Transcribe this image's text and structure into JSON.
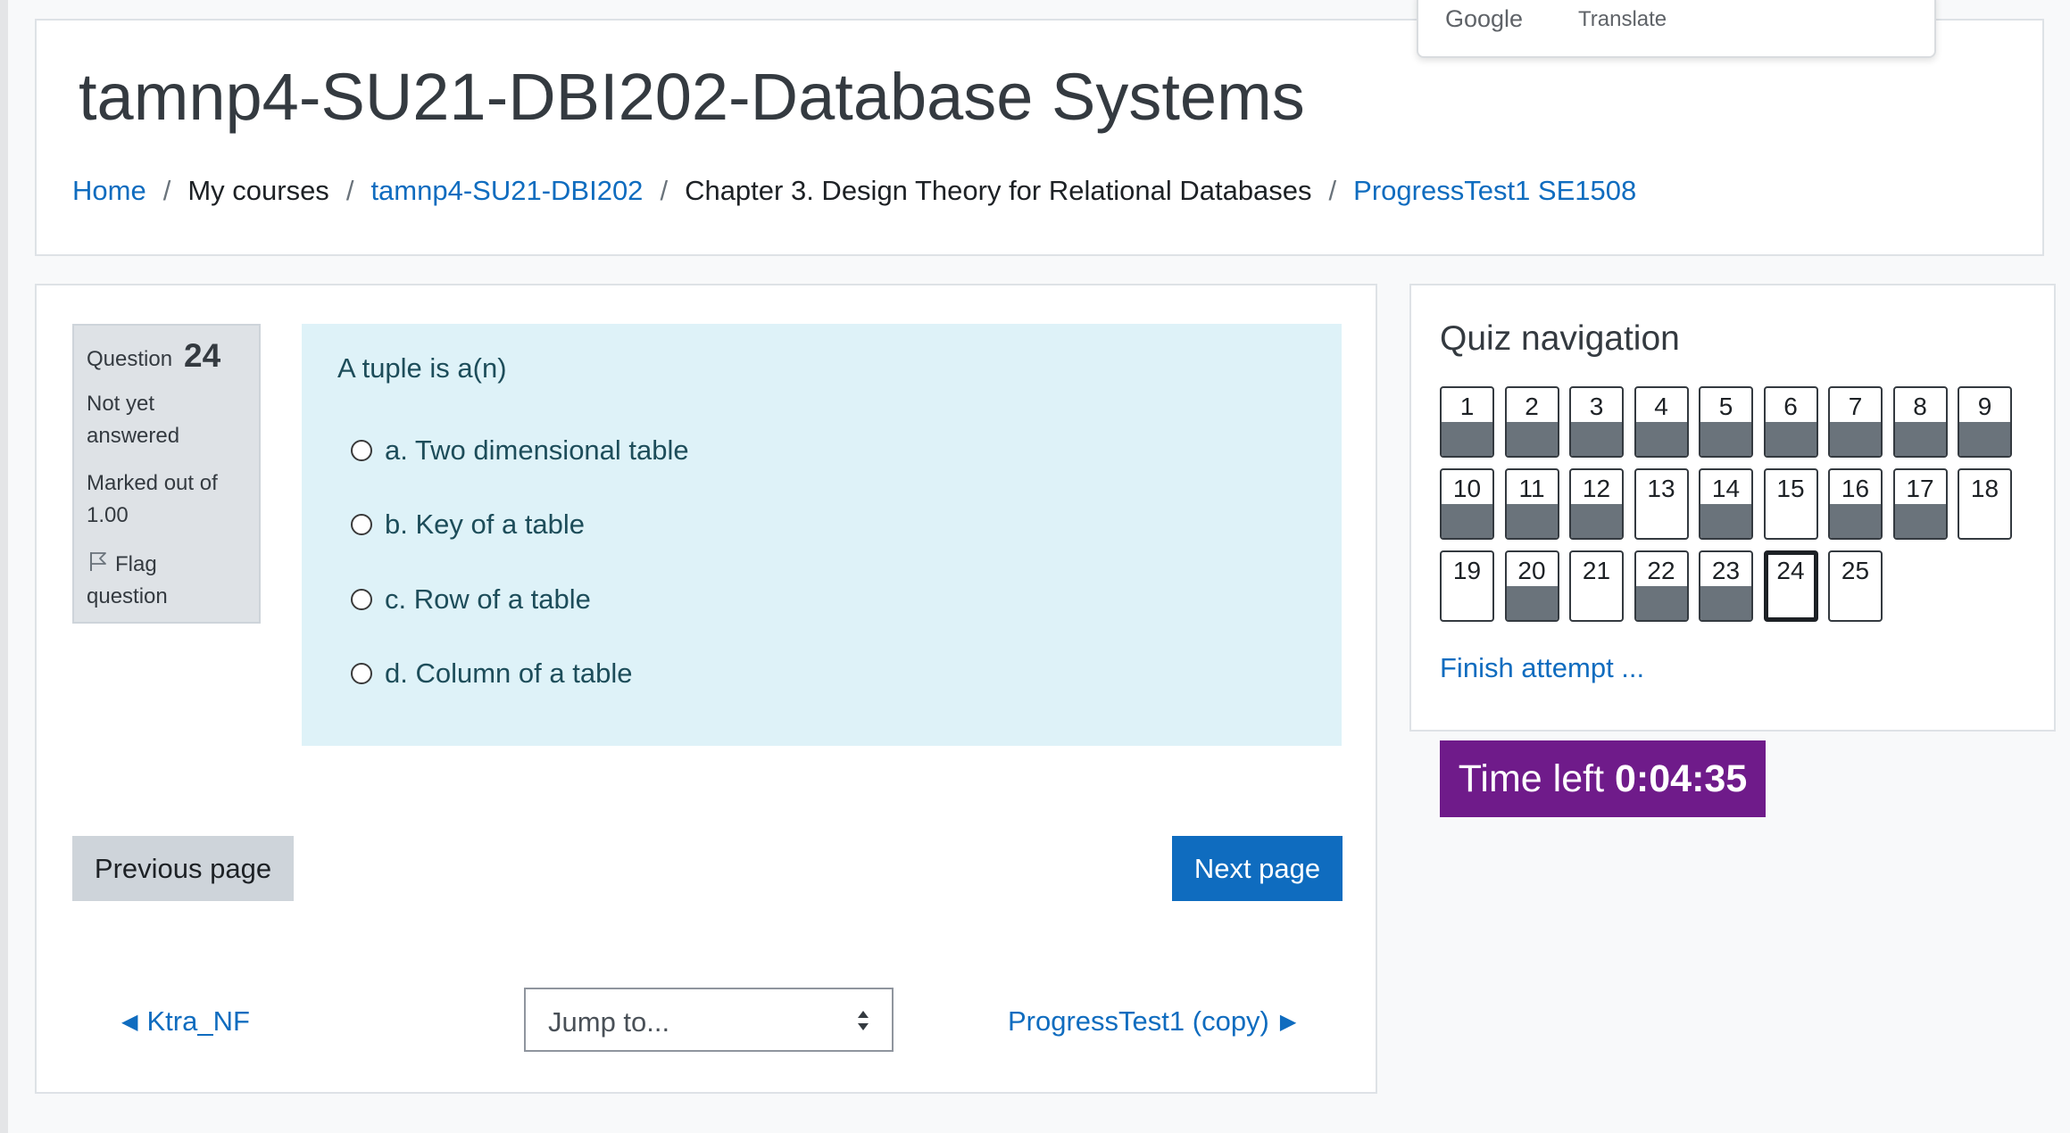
{
  "header": {
    "title": "tamnp4-SU21-DBI202-Database Systems",
    "breadcrumb": [
      {
        "label": "Home",
        "link": true
      },
      {
        "label": "My courses",
        "link": false
      },
      {
        "label": "tamnp4-SU21-DBI202",
        "link": true
      },
      {
        "label": "Chapter 3. Design Theory for Relational Databases",
        "link": false
      },
      {
        "label": "ProgressTest1 SE1508",
        "link": true
      }
    ]
  },
  "translate_popup": {
    "google": "Google",
    "translate": "Translate"
  },
  "question_info": {
    "label": "Question",
    "number": "24",
    "status": "Not yet answered",
    "marked": "Marked out of 1.00",
    "flag": "Flag question",
    "flag_icon": "flag-icon"
  },
  "question": {
    "text": "A tuple is a(n)",
    "options": [
      "a. Two dimensional table",
      "b. Key of a table",
      "c. Row of a table",
      "d. Column of a table"
    ]
  },
  "buttons": {
    "previous": "Previous page",
    "next": "Next page"
  },
  "activity_nav": {
    "previous": "Ktra_NF",
    "previous_arrow": "◀",
    "next": "ProgressTest1 (copy)",
    "next_arrow": "▶",
    "jump_placeholder": "Jump to..."
  },
  "quiz_navigation": {
    "title": "Quiz navigation",
    "questions": [
      {
        "n": "1",
        "answered": true
      },
      {
        "n": "2",
        "answered": true
      },
      {
        "n": "3",
        "answered": true
      },
      {
        "n": "4",
        "answered": true
      },
      {
        "n": "5",
        "answered": true
      },
      {
        "n": "6",
        "answered": true
      },
      {
        "n": "7",
        "answered": true
      },
      {
        "n": "8",
        "answered": true
      },
      {
        "n": "9",
        "answered": true
      },
      {
        "n": "10",
        "answered": true
      },
      {
        "n": "11",
        "answered": true
      },
      {
        "n": "12",
        "answered": true
      },
      {
        "n": "13",
        "answered": false
      },
      {
        "n": "14",
        "answered": true
      },
      {
        "n": "15",
        "answered": false
      },
      {
        "n": "16",
        "answered": true
      },
      {
        "n": "17",
        "answered": true
      },
      {
        "n": "18",
        "answered": false
      },
      {
        "n": "19",
        "answered": false
      },
      {
        "n": "20",
        "answered": true
      },
      {
        "n": "21",
        "answered": false
      },
      {
        "n": "22",
        "answered": true
      },
      {
        "n": "23",
        "answered": true
      },
      {
        "n": "24",
        "answered": false,
        "current": true
      },
      {
        "n": "25",
        "answered": false
      }
    ],
    "finish": "Finish attempt ..."
  },
  "timer": {
    "label": "Time left",
    "value": "0:04:35",
    "color": "#6f1b8a"
  },
  "colors": {
    "link": "#0f6cbf",
    "question_bg": "#def2f8",
    "answered_fill": "#6a737b"
  }
}
